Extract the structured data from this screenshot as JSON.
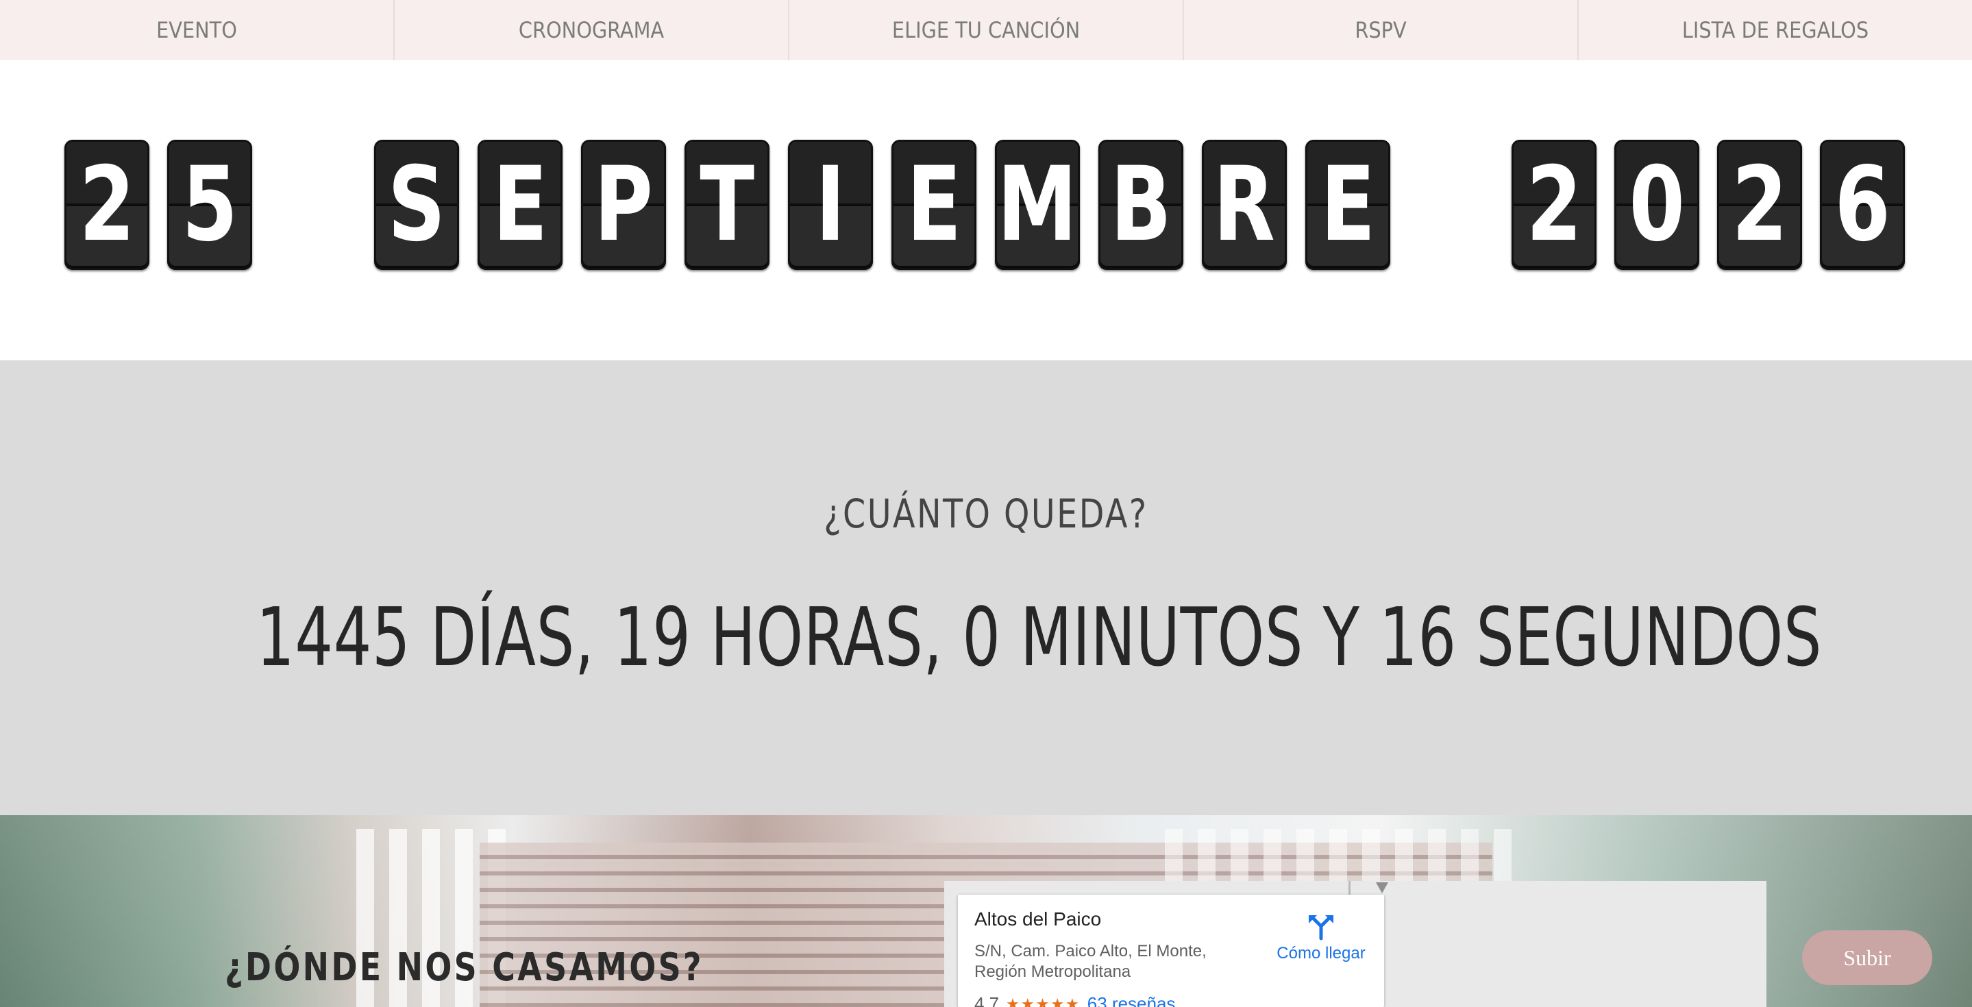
{
  "nav": {
    "items": [
      "EVENTO",
      "CRONOGRAMA",
      "ELIGE TU CANCIÓN",
      "RSPV",
      "LISTA DE REGALOS"
    ]
  },
  "date": {
    "day": [
      "2",
      "5"
    ],
    "month": [
      "S",
      "E",
      "P",
      "T",
      "I",
      "E",
      "M",
      "B",
      "R",
      "E"
    ],
    "year": [
      "2",
      "0",
      "2",
      "6"
    ]
  },
  "countdown": {
    "title": "¿CUÁNTO QUEDA?",
    "value": "1445 DÍAS, 19 HORAS, 0 MINUTOS Y 16 SEGUNDOS"
  },
  "where": {
    "title": "¿DÓNDE NOS CASAMOS?"
  },
  "map": {
    "place_name": "Altos del Paico",
    "address": "S/N, Cam. Paico Alto, El Monte, Región Metropolitana",
    "rating": "4,7",
    "stars": "★★★★★",
    "reviews": "63 reseñas",
    "directions_label": "Cómo llegar"
  },
  "scroll_top_button": "Subir",
  "colors": {
    "nav_bg": "#f8eeee",
    "countdown_bg": "#dcdbdb",
    "button_bg": "#c9a5a3",
    "link": "#1a73e8"
  }
}
